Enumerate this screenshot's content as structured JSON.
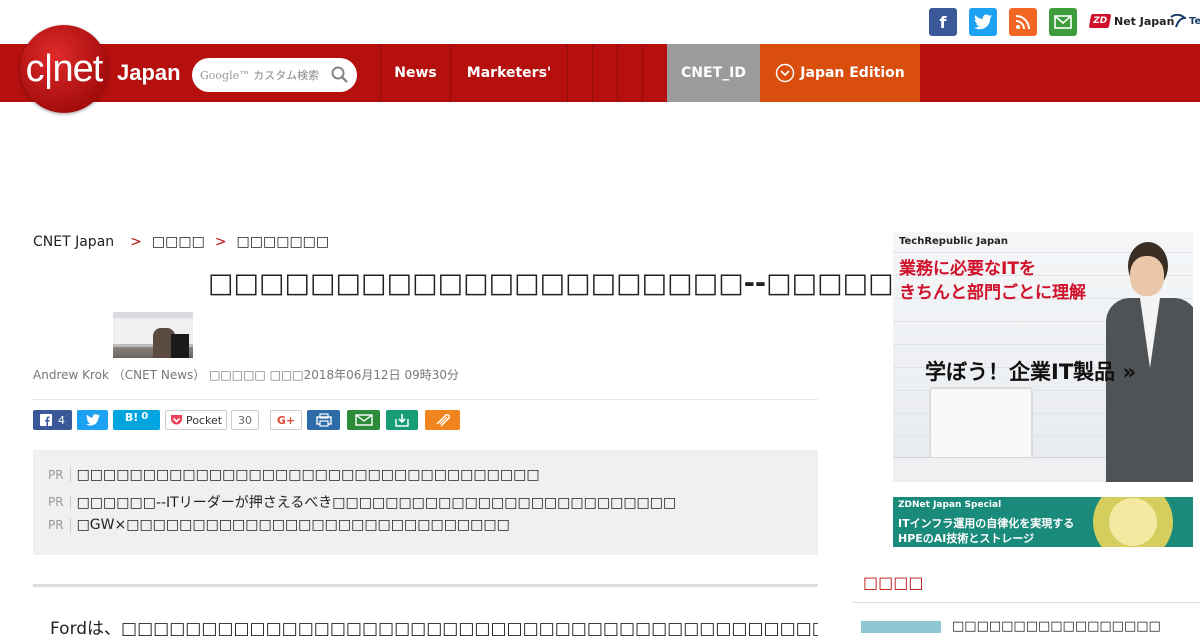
{
  "social": {
    "zdnet_label": "Net Japan",
    "zdnet_mark": "ZD",
    "techrepublic_label": "Tech"
  },
  "header": {
    "logo_text": "c|net",
    "logo_suffix": "Japan",
    "search_placeholder": "カスタム検索",
    "search_brand": "Google™",
    "nav": [
      "News",
      "Marketers'",
      "",
      "",
      ""
    ],
    "cnet_id": "CNET_ID",
    "edition": "Japan Edition"
  },
  "breadcrumb": {
    "root": "CNET Japan",
    "level1": "□□□□",
    "level2": "□□□□□□□"
  },
  "article": {
    "title": "□□□□□□□□□□□□□□□□□□□□□--□□□□□",
    "byline": "Andrew Krok （CNET News） □□□□□ □□□2018年06月12日 09時30分",
    "body_start": "　Fordは、□□□□□□□□□□□□□□□□□□□□□□□□□□□□□□□□□□□□□□□□□□□□□□□□□□□□□"
  },
  "share": {
    "facebook_count": "4",
    "hatena_label": "B!",
    "hatena_count": "0",
    "pocket_label": "Pocket",
    "pocket_count": "30",
    "gplus_label": "G+"
  },
  "pr_links": [
    {
      "tag": "PR",
      "text": "□□□□□□□□□□□□□□□□□□□□□□□□□□□□□□□□□□□"
    },
    {
      "tag": "PR",
      "text": "□□□□□□--ITリーダーが押さえるべき□□□□□□□□□□□□□□□□□□□□□□□□□□"
    },
    {
      "tag": "PR",
      "text": "□GW×□□□□□□□□□□□□□□□□□□□□□□□□□□□□□"
    }
  ],
  "ads": {
    "ad1_brand": "TechRepublic Japan",
    "ad1_line1": "業務に必要なITを",
    "ad1_line2": "きちんと部門ごとに理解",
    "ad1_cta": "学ぼう！企業IT製品 »",
    "ad2_brand": "ZDNet Japan Special",
    "ad2_line1": "ITインフラ運用の自律化を実現する",
    "ad2_line2": "HPEのAI技術とストレージ"
  },
  "sidebar": {
    "heading": "□□□□",
    "item1": "□□□□□□□□□□□□□□□□□"
  },
  "colors": {
    "brand_red": "#b5100e",
    "edition_orange": "#d94e0d",
    "cnet_id_gray": "#9b9b9b"
  }
}
